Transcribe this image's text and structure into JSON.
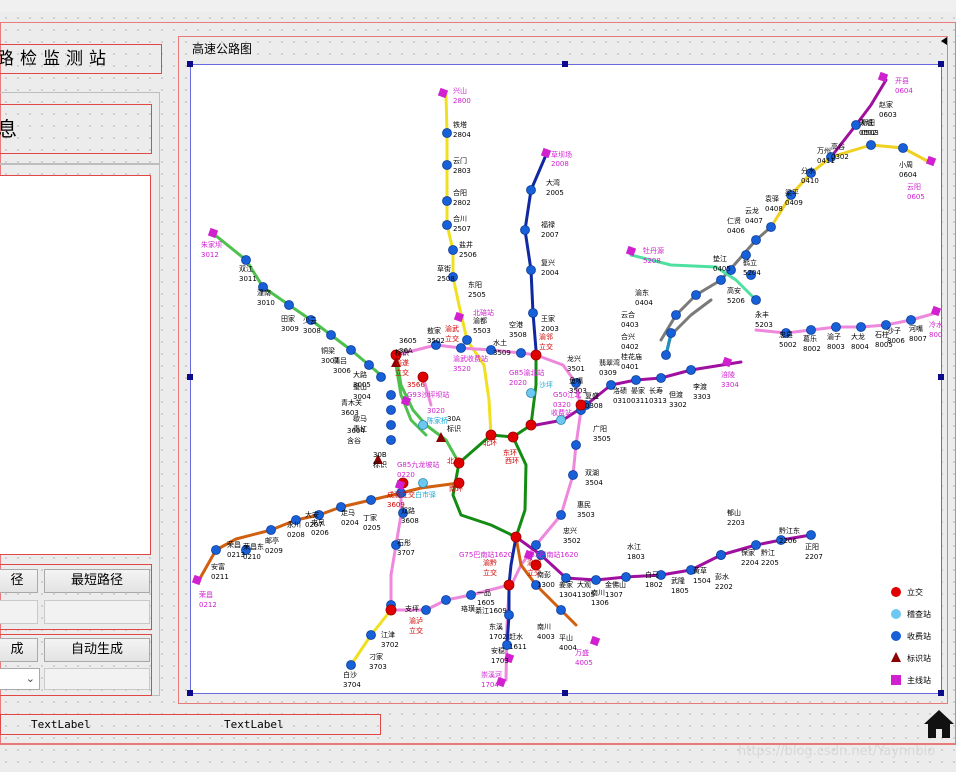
{
  "app": {
    "title_fragment": "路检监测站",
    "info_fragment": "息"
  },
  "buttons": {
    "path_fragment": "径",
    "shortest_path": "最短路径",
    "generate_fragment": "成",
    "auto_generate": "自动生成"
  },
  "map": {
    "title": "高速公路图",
    "legend": [
      {
        "label": "立交",
        "color": "#e00000",
        "shape": "circle"
      },
      {
        "label": "稽查站",
        "color": "#6cc8f0",
        "shape": "circle"
      },
      {
        "label": "收费站",
        "color": "#1860d8",
        "shape": "circle"
      },
      {
        "label": "标识站",
        "color": "#8b0000",
        "shape": "triangle"
      },
      {
        "label": "主线站",
        "color": "#d020d0",
        "shape": "square"
      }
    ],
    "labels": [
      {
        "t": "兴山",
        "c": "#d020d0"
      },
      {
        "t": "2800",
        "c": "#d020d0"
      },
      {
        "t": "铁塔",
        "c": "#000"
      },
      {
        "t": "2804",
        "c": "#000"
      },
      {
        "t": "云门",
        "c": "#000"
      },
      {
        "t": "2803",
        "c": "#000"
      },
      {
        "t": "合阳",
        "c": "#000"
      },
      {
        "t": "2802",
        "c": "#000"
      },
      {
        "t": "合川",
        "c": "#000"
      },
      {
        "t": "2507",
        "c": "#000"
      },
      {
        "t": "盐井",
        "c": "#000"
      },
      {
        "t": "2506",
        "c": "#000"
      },
      {
        "t": "草街",
        "c": "#000"
      },
      {
        "t": "2508",
        "c": "#000"
      },
      {
        "t": "东阳",
        "c": "#000"
      },
      {
        "t": "2505",
        "c": "#000"
      },
      {
        "t": "草坝场",
        "c": "#d020d0"
      },
      {
        "t": "2008",
        "c": "#d020d0"
      },
      {
        "t": "大湾",
        "c": "#000"
      },
      {
        "t": "2005",
        "c": "#000"
      },
      {
        "t": "福禄",
        "c": "#000"
      },
      {
        "t": "2007",
        "c": "#000"
      },
      {
        "t": "复兴",
        "c": "#000"
      },
      {
        "t": "2004",
        "c": "#000"
      },
      {
        "t": "王家",
        "c": "#000"
      },
      {
        "t": "2003",
        "c": "#000"
      },
      {
        "t": "渝都",
        "c": "#000"
      },
      {
        "t": "5503",
        "c": "#000"
      },
      {
        "t": "空港",
        "c": "#000"
      },
      {
        "t": "3508",
        "c": "#000"
      },
      {
        "t": "敖家",
        "c": "#000"
      },
      {
        "t": "3502",
        "c": "#000"
      },
      {
        "t": "渝武",
        "c": "#d00000"
      },
      {
        "t": "立交",
        "c": "#d00000"
      },
      {
        "t": "北碚站",
        "c": "#d020d0"
      },
      {
        "t": "渝武收费站",
        "c": "#d020d0"
      },
      {
        "t": "3520",
        "c": "#d020d0"
      },
      {
        "t": "水土",
        "c": "#000"
      },
      {
        "t": "3509",
        "c": "#000"
      },
      {
        "t": "G85渝北站",
        "c": "#d020d0"
      },
      {
        "t": "2020",
        "c": "#d020d0"
      },
      {
        "t": "渝邻",
        "c": "#d00000"
      },
      {
        "t": "立交",
        "c": "#d00000"
      },
      {
        "t": "沙坪",
        "c": "#18a8d8"
      },
      {
        "t": "龙兴",
        "c": "#000"
      },
      {
        "t": "3501",
        "c": "#000"
      },
      {
        "t": "翡翠湾",
        "c": "#000"
      },
      {
        "t": "0309",
        "c": "#000"
      },
      {
        "t": "鱼嘴",
        "c": "#000"
      },
      {
        "t": "3503",
        "c": "#000"
      },
      {
        "t": "复盛",
        "c": "#000"
      },
      {
        "t": "0308",
        "c": "#000"
      },
      {
        "t": "洛碛",
        "c": "#000"
      },
      {
        "t": "0310",
        "c": "#000"
      },
      {
        "t": "晏家",
        "c": "#000"
      },
      {
        "t": "0311",
        "c": "#000"
      },
      {
        "t": "长寿",
        "c": "#000"
      },
      {
        "t": "0313",
        "c": "#000"
      },
      {
        "t": "但渡",
        "c": "#000"
      },
      {
        "t": "3302",
        "c": "#000"
      },
      {
        "t": "李渡",
        "c": "#000"
      },
      {
        "t": "3303",
        "c": "#000"
      },
      {
        "t": "涪陵",
        "c": "#d020d0"
      },
      {
        "t": "3304",
        "c": "#d020d0"
      },
      {
        "t": "G50江北",
        "c": "#d020d0"
      },
      {
        "t": "0320",
        "c": "#d020d0"
      },
      {
        "t": "收费站",
        "c": "#d020d0"
      },
      {
        "t": "广阳",
        "c": "#000"
      },
      {
        "t": "3505",
        "c": "#000"
      },
      {
        "t": "双湖",
        "c": "#000"
      },
      {
        "t": "3504",
        "c": "#000"
      },
      {
        "t": "惠民",
        "c": "#000"
      },
      {
        "t": "3503",
        "c": "#000"
      },
      {
        "t": "忠兴",
        "c": "#000"
      },
      {
        "t": "3502",
        "c": "#000"
      },
      {
        "t": "牡丹源",
        "c": "#d020d0"
      },
      {
        "t": "5208",
        "c": "#d020d0"
      },
      {
        "t": "垫江",
        "c": "#000"
      },
      {
        "t": "0405",
        "c": "#000"
      },
      {
        "t": "渝东",
        "c": "#000"
      },
      {
        "t": "0404",
        "c": "#000"
      },
      {
        "t": "云合",
        "c": "#000"
      },
      {
        "t": "0403",
        "c": "#000"
      },
      {
        "t": "合兴",
        "c": "#000"
      },
      {
        "t": "0402",
        "c": "#000"
      },
      {
        "t": "桂花庙",
        "c": "#000"
      },
      {
        "t": "0401",
        "c": "#000"
      },
      {
        "t": "鹤立",
        "c": "#000"
      },
      {
        "t": "5204",
        "c": "#000"
      },
      {
        "t": "高安",
        "c": "#000"
      },
      {
        "t": "5206",
        "c": "#000"
      },
      {
        "t": "永丰",
        "c": "#000"
      },
      {
        "t": "5203",
        "c": "#000"
      },
      {
        "t": "忠县",
        "c": "#000"
      },
      {
        "t": "5002",
        "c": "#000"
      },
      {
        "t": "葛乐",
        "c": "#000"
      },
      {
        "t": "8002",
        "c": "#000"
      },
      {
        "t": "渝子",
        "c": "#000"
      },
      {
        "t": "8003",
        "c": "#000"
      },
      {
        "t": "大龙",
        "c": "#000"
      },
      {
        "t": "8004",
        "c": "#000"
      },
      {
        "t": "石柱",
        "c": "#000"
      },
      {
        "t": "8005",
        "c": "#000"
      },
      {
        "t": "沙子",
        "c": "#000"
      },
      {
        "t": "8006",
        "c": "#000"
      },
      {
        "t": "河嘴",
        "c": "#000"
      },
      {
        "t": "8007",
        "c": "#000"
      },
      {
        "t": "冷水",
        "c": "#d020d0"
      },
      {
        "t": "8008",
        "c": "#d020d0"
      },
      {
        "t": "开县",
        "c": "#d020d0"
      },
      {
        "t": "0604",
        "c": "#d020d0"
      },
      {
        "t": "赵家",
        "c": "#000"
      },
      {
        "t": "0603",
        "c": "#000"
      },
      {
        "t": "天城",
        "c": "#000"
      },
      {
        "t": "0502",
        "c": "#000"
      },
      {
        "t": "新田",
        "c": "#000"
      },
      {
        "t": "0503",
        "c": "#000"
      },
      {
        "t": "高谷",
        "c": "#000"
      },
      {
        "t": "0302",
        "c": "#000"
      },
      {
        "t": "万州",
        "c": "#000"
      },
      {
        "t": "0411",
        "c": "#000"
      },
      {
        "t": "分水",
        "c": "#000"
      },
      {
        "t": "0410",
        "c": "#000"
      },
      {
        "t": "梁平",
        "c": "#000"
      },
      {
        "t": "0409",
        "c": "#000"
      },
      {
        "t": "袁驿",
        "c": "#000"
      },
      {
        "t": "0408",
        "c": "#000"
      },
      {
        "t": "云龙",
        "c": "#000"
      },
      {
        "t": "0407",
        "c": "#000"
      },
      {
        "t": "仁贤",
        "c": "#000"
      },
      {
        "t": "0406",
        "c": "#000"
      },
      {
        "t": "小周",
        "c": "#000"
      },
      {
        "t": "0604",
        "c": "#000"
      },
      {
        "t": "云阳",
        "c": "#d020d0"
      },
      {
        "t": "0605",
        "c": "#d020d0"
      },
      {
        "t": "朱家坝",
        "c": "#d020d0"
      },
      {
        "t": "3012",
        "c": "#d020d0"
      },
      {
        "t": "双江",
        "c": "#000"
      },
      {
        "t": "3011",
        "c": "#000"
      },
      {
        "t": "潼南",
        "c": "#000"
      },
      {
        "t": "3010",
        "c": "#000"
      },
      {
        "t": "田家",
        "c": "#000"
      },
      {
        "t": "3009",
        "c": "#000"
      },
      {
        "t": "少云",
        "c": "#000"
      },
      {
        "t": "3008",
        "c": "#000"
      },
      {
        "t": "铜梁",
        "c": "#000"
      },
      {
        "t": "3007",
        "c": "#000"
      },
      {
        "t": "蒲吕",
        "c": "#000"
      },
      {
        "t": "3006",
        "c": "#000"
      },
      {
        "t": "大路",
        "c": "#000"
      },
      {
        "t": "3005",
        "c": "#000"
      },
      {
        "t": "璧山",
        "c": "#000"
      },
      {
        "t": "3004",
        "c": "#000"
      },
      {
        "t": "青木关",
        "c": "#000"
      },
      {
        "t": "3603",
        "c": "#000"
      },
      {
        "t": "歇马",
        "c": "#000"
      },
      {
        "t": "青杠",
        "c": "#000"
      },
      {
        "t": "3604",
        "c": "#000"
      },
      {
        "t": "含谷",
        "c": "#000"
      },
      {
        "t": "3605",
        "c": "#000"
      },
      {
        "t": "36A",
        "c": "#000"
      },
      {
        "t": "标识",
        "c": "#000"
      },
      {
        "t": "渝遂",
        "c": "#d00000"
      },
      {
        "t": "立交",
        "c": "#d00000"
      },
      {
        "t": "3566",
        "c": "#d00000"
      },
      {
        "t": "G93沙坪坝站",
        "c": "#d020d0"
      },
      {
        "t": "3020",
        "c": "#d020d0"
      },
      {
        "t": "陈家桥",
        "c": "#18a8d8"
      },
      {
        "t": "30A",
        "c": "#000"
      },
      {
        "t": "标识",
        "c": "#000"
      },
      {
        "t": "北碚",
        "c": "#d00000"
      },
      {
        "t": "北环",
        "c": "#d00000"
      },
      {
        "t": "东环",
        "c": "#d00000"
      },
      {
        "t": "西环",
        "c": "#d00000"
      },
      {
        "t": "南环",
        "c": "#d00000"
      },
      {
        "t": "30B",
        "c": "#000"
      },
      {
        "t": "标识",
        "c": "#000"
      },
      {
        "t": "G85九龙坡站",
        "c": "#d020d0"
      },
      {
        "t": "0220",
        "c": "#d020d0"
      },
      {
        "t": "白市驿",
        "c": "#18a8d8"
      },
      {
        "t": "成渝立交",
        "c": "#d00000"
      },
      {
        "t": "3609",
        "c": "#d00000"
      },
      {
        "t": "双路",
        "c": "#000"
      },
      {
        "t": "3608",
        "c": "#000"
      },
      {
        "t": "石彤",
        "c": "#000"
      },
      {
        "t": "3707",
        "c": "#000"
      },
      {
        "t": "走马",
        "c": "#000"
      },
      {
        "t": "0204",
        "c": "#000"
      },
      {
        "t": "丁家",
        "c": "#000"
      },
      {
        "t": "0205",
        "c": "#000"
      },
      {
        "t": "来凤",
        "c": "#000"
      },
      {
        "t": "0206",
        "c": "#000"
      },
      {
        "t": "大安",
        "c": "#000"
      },
      {
        "t": "0207",
        "c": "#000"
      },
      {
        "t": "永川",
        "c": "#000"
      },
      {
        "t": "0208",
        "c": "#000"
      },
      {
        "t": "邮亭",
        "c": "#000"
      },
      {
        "t": "0209",
        "c": "#000"
      },
      {
        "t": "荣昌东",
        "c": "#000"
      },
      {
        "t": "0210",
        "c": "#000"
      },
      {
        "t": "荣昌",
        "c": "#000"
      },
      {
        "t": "0213",
        "c": "#000"
      },
      {
        "t": "安富",
        "c": "#000"
      },
      {
        "t": "0211",
        "c": "#000"
      },
      {
        "t": "荣昌",
        "c": "#d020d0"
      },
      {
        "t": "0212",
        "c": "#d020d0"
      },
      {
        "t": "G75巴南站1620",
        "c": "#d020d0"
      },
      {
        "t": "渝黔",
        "c": "#d00000"
      },
      {
        "t": "立交",
        "c": "#d00000"
      },
      {
        "t": "G65巴南站1620",
        "c": "#d020d0"
      },
      {
        "t": "渝湘",
        "c": "#d00000"
      },
      {
        "t": "立交",
        "c": "#d00000"
      },
      {
        "t": "一品",
        "c": "#000"
      },
      {
        "t": "1605",
        "c": "#000"
      },
      {
        "t": "綦江1609",
        "c": "#000"
      },
      {
        "t": "渝泸",
        "c": "#d00000"
      },
      {
        "t": "立交",
        "c": "#d00000"
      },
      {
        "t": "支坪",
        "c": "#000"
      },
      {
        "t": "珞璜",
        "c": "#000"
      },
      {
        "t": "江津",
        "c": "#000"
      },
      {
        "t": "3702",
        "c": "#000"
      },
      {
        "t": "刁家",
        "c": "#000"
      },
      {
        "t": "3703",
        "c": "#000"
      },
      {
        "t": "白沙",
        "c": "#000"
      },
      {
        "t": "3704",
        "c": "#000"
      },
      {
        "t": "东溪",
        "c": "#000"
      },
      {
        "t": "1702",
        "c": "#000"
      },
      {
        "t": "安稳",
        "c": "#000"
      },
      {
        "t": "1703",
        "c": "#000"
      },
      {
        "t": "崇溪河",
        "c": "#d020d0"
      },
      {
        "t": "1704",
        "c": "#d020d0"
      },
      {
        "t": "赶水",
        "c": "#000"
      },
      {
        "t": "1611",
        "c": "#000"
      },
      {
        "t": "南川",
        "c": "#000"
      },
      {
        "t": "4003",
        "c": "#000"
      },
      {
        "t": "平山",
        "c": "#000"
      },
      {
        "t": "4004",
        "c": "#000"
      },
      {
        "t": "万盛",
        "c": "#d020d0"
      },
      {
        "t": "4005",
        "c": "#d020d0"
      },
      {
        "t": "南彭",
        "c": "#000"
      },
      {
        "t": "1300",
        "c": "#000"
      },
      {
        "t": "姜家",
        "c": "#000"
      },
      {
        "t": "1304",
        "c": "#000"
      },
      {
        "t": "大观",
        "c": "#000"
      },
      {
        "t": "1305",
        "c": "#000"
      },
      {
        "t": "南川",
        "c": "#000"
      },
      {
        "t": "1306",
        "c": "#000"
      },
      {
        "t": "金佛山",
        "c": "#000"
      },
      {
        "t": "1307",
        "c": "#000"
      },
      {
        "t": "水江",
        "c": "#000"
      },
      {
        "t": "1803",
        "c": "#000"
      },
      {
        "t": "白马",
        "c": "#000"
      },
      {
        "t": "1802",
        "c": "#000"
      },
      {
        "t": "武隆",
        "c": "#000"
      },
      {
        "t": "1805",
        "c": "#000"
      },
      {
        "t": "黄草",
        "c": "#000"
      },
      {
        "t": "1504",
        "c": "#000"
      },
      {
        "t": "彭水",
        "c": "#000"
      },
      {
        "t": "2202",
        "c": "#000"
      },
      {
        "t": "郁山",
        "c": "#000"
      },
      {
        "t": "2203",
        "c": "#000"
      },
      {
        "t": "保家",
        "c": "#000"
      },
      {
        "t": "2204",
        "c": "#000"
      },
      {
        "t": "黔江",
        "c": "#000"
      },
      {
        "t": "2205",
        "c": "#000"
      },
      {
        "t": "黔江东",
        "c": "#000"
      },
      {
        "t": "2206",
        "c": "#000"
      },
      {
        "t": "正阳",
        "c": "#000"
      },
      {
        "t": "2207",
        "c": "#000"
      }
    ]
  },
  "footer": {
    "label1": "TextLabel",
    "label2": "TextLabel",
    "watermark": "https://blog.csdn.net/Yaynnbio"
  }
}
